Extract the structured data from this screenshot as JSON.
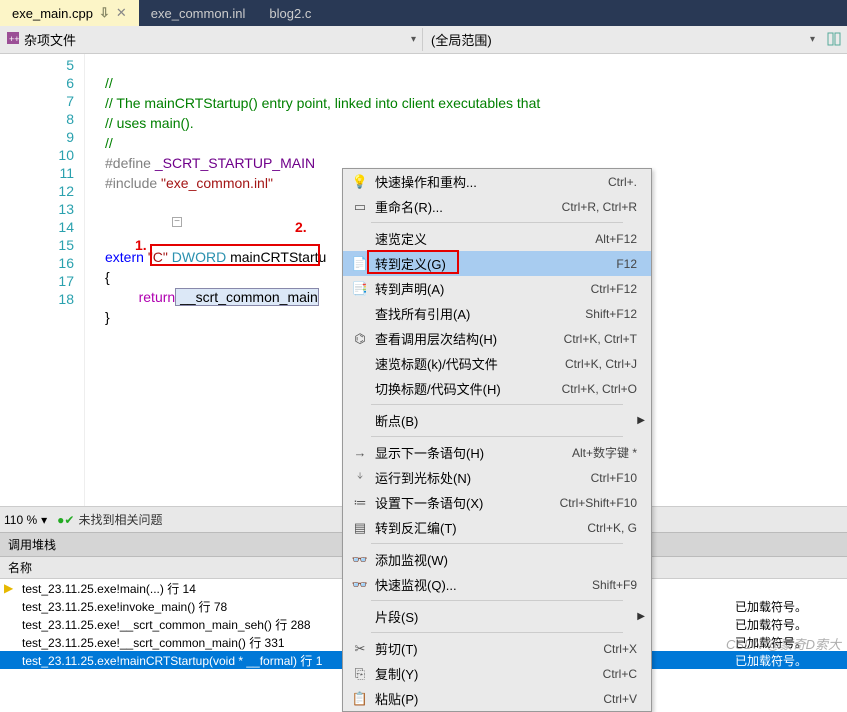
{
  "tabs": [
    {
      "label": "exe_main.cpp",
      "active": true,
      "pinned": true
    },
    {
      "label": "exe_common.inl",
      "active": false
    },
    {
      "label": "blog2.c",
      "active": false
    }
  ],
  "toolbar": {
    "left_label": "杂项文件",
    "right_label": "(全局范围)"
  },
  "gutter_lines": [
    "5",
    "6",
    "7",
    "8",
    "9",
    "10",
    "11",
    "12",
    "13",
    "14",
    "15",
    "16",
    "17",
    "18"
  ],
  "code": {
    "l5": "//",
    "l6_a": "// The mainCRTStartup() entry point, linked into client executables that",
    "l7_a": "// uses main().",
    "l8": "//",
    "l9_def": "#define ",
    "l9_mac": "_SCRT_STARTUP_MAIN",
    "l10_inc": "#include ",
    "l10_str": "\"exe_common.inl\"",
    "l14_ext": "extern ",
    "l14_c": "\"C\"",
    "l14_dw": " DWORD ",
    "l14_fn": "mainCRTStartu",
    "l15": "{",
    "l16_ret": "return",
    "l16_call": " __scrt_common_main",
    "l17": "}"
  },
  "annotations": {
    "a1": "1.",
    "a2": "2."
  },
  "menu": [
    {
      "type": "item",
      "icon": "bulb",
      "label": "快速操作和重构...",
      "shortcut": "Ctrl+."
    },
    {
      "type": "item",
      "icon": "rename",
      "label": "重命名(R)...",
      "shortcut": "Ctrl+R, Ctrl+R"
    },
    {
      "type": "sep"
    },
    {
      "type": "item",
      "icon": "",
      "label": "速览定义",
      "shortcut": "Alt+F12"
    },
    {
      "type": "item",
      "icon": "goto",
      "label": "转到定义(G)",
      "shortcut": "F12",
      "selected": true,
      "highlighted": true
    },
    {
      "type": "item",
      "icon": "decl",
      "label": "转到声明(A)",
      "shortcut": "Ctrl+F12"
    },
    {
      "type": "item",
      "icon": "",
      "label": "查找所有引用(A)",
      "shortcut": "Shift+F12"
    },
    {
      "type": "item",
      "icon": "hier",
      "label": "查看调用层次结构(H)",
      "shortcut": "Ctrl+K, Ctrl+T"
    },
    {
      "type": "item",
      "icon": "",
      "label": "速览标题(k)/代码文件",
      "shortcut": "Ctrl+K, Ctrl+J"
    },
    {
      "type": "item",
      "icon": "",
      "label": "切换标题/代码文件(H)",
      "shortcut": "Ctrl+K, Ctrl+O"
    },
    {
      "type": "sep"
    },
    {
      "type": "sub",
      "icon": "",
      "label": "断点(B)"
    },
    {
      "type": "sep"
    },
    {
      "type": "item",
      "icon": "arrow",
      "label": "显示下一条语句(H)",
      "shortcut": "Alt+数字键 *"
    },
    {
      "type": "item",
      "icon": "cursor",
      "label": "运行到光标处(N)",
      "shortcut": "Ctrl+F10"
    },
    {
      "type": "item",
      "icon": "setnext",
      "label": "设置下一条语句(X)",
      "shortcut": "Ctrl+Shift+F10"
    },
    {
      "type": "item",
      "icon": "asm",
      "label": "转到反汇编(T)",
      "shortcut": "Ctrl+K, G"
    },
    {
      "type": "sep"
    },
    {
      "type": "item",
      "icon": "watch",
      "label": "添加监视(W)",
      "shortcut": ""
    },
    {
      "type": "item",
      "icon": "qwatch",
      "label": "快速监视(Q)...",
      "shortcut": "Shift+F9"
    },
    {
      "type": "sep"
    },
    {
      "type": "sub",
      "icon": "",
      "label": "片段(S)"
    },
    {
      "type": "sep"
    },
    {
      "type": "item",
      "icon": "cut",
      "label": "剪切(T)",
      "shortcut": "Ctrl+X"
    },
    {
      "type": "item",
      "icon": "copy",
      "label": "复制(Y)",
      "shortcut": "Ctrl+C"
    },
    {
      "type": "item",
      "icon": "paste",
      "label": "粘贴(P)",
      "shortcut": "Ctrl+V"
    }
  ],
  "zoom": "110 %",
  "no_issues": "未找到相关问题",
  "callstack": {
    "title": "调用堆栈",
    "col_name": "名称",
    "rows": [
      {
        "arrow": true,
        "text": "test_23.11.25.exe!main(...) 行 14"
      },
      {
        "text": "test_23.11.25.exe!invoke_main() 行 78",
        "right": "已加载符号。"
      },
      {
        "text": "test_23.11.25.exe!__scrt_common_main_seh() 行 288",
        "right": "已加载符号。"
      },
      {
        "text": "test_23.11.25.exe!__scrt_common_main() 行 331",
        "right": "已加载符号。"
      },
      {
        "text": "test_23.11.25.exe!mainCRTStartup(void * __formal) 行 1",
        "right": "已加载符号。",
        "selected": true
      }
    ]
  },
  "watermark": "CSDN @蒙奇D索大"
}
